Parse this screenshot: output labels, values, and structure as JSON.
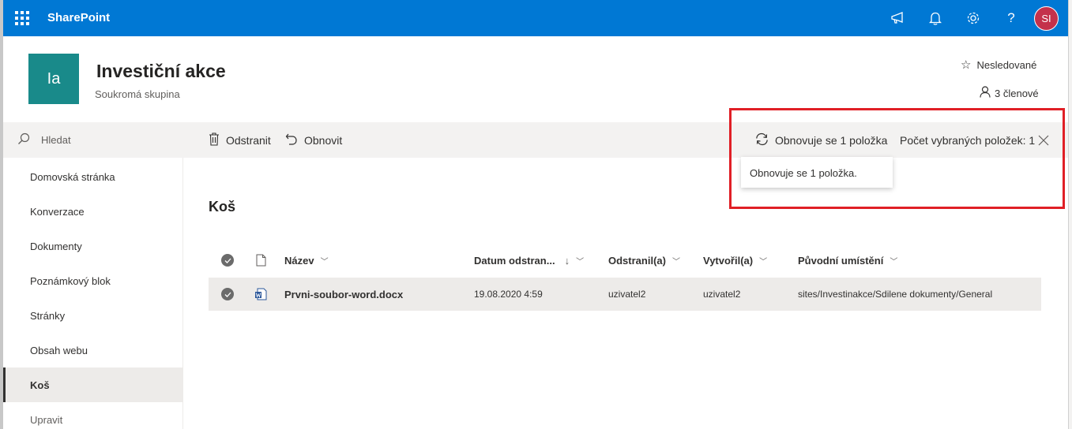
{
  "suite_bar": {
    "app_title": "SharePoint",
    "avatar_initials": "SI",
    "bg_color": "#0078d4",
    "icons": [
      "waffle-icon",
      "megaphone-icon",
      "bell-icon",
      "gear-icon",
      "help-icon"
    ]
  },
  "site": {
    "logo_text": "Ia",
    "title": "Investiční akce",
    "subtitle": "Soukromá skupina",
    "follow_label": "Nesledované",
    "members_label": "3 členové"
  },
  "search": {
    "placeholder": "Hledat"
  },
  "command_bar": {
    "delete_label": "Odstranit",
    "restore_label": "Obnovit",
    "status_label": "Obnovuje se 1 položka",
    "selected_count_label": "Počet vybraných položek: 1"
  },
  "tooltip": {
    "text": "Obnovuje se 1 položka."
  },
  "left_nav": {
    "items": [
      {
        "label": "Domovská stránka"
      },
      {
        "label": "Konverzace"
      },
      {
        "label": "Dokumenty"
      },
      {
        "label": "Poznámkový blok"
      },
      {
        "label": "Stránky"
      },
      {
        "label": "Obsah webu"
      },
      {
        "label": "Koš",
        "selected": true
      }
    ],
    "edit_label": "Upravit"
  },
  "main": {
    "heading": "Koš",
    "columns": {
      "name": "Název",
      "deleted_date": "Datum odstran...",
      "deleted_by": "Odstranil(a)",
      "created_by": "Vytvořil(a)",
      "original_location": "Původní umístění"
    },
    "rows": [
      {
        "name": "Prvni-soubor-word.docx",
        "deleted_date": "19.08.2020 4:59",
        "deleted_by": "uzivatel2",
        "created_by": "uzivatel2",
        "original_location": "sites/Investinakce/Sdilene dokumenty/General",
        "file_icon": "word-file-icon"
      }
    ]
  },
  "highlight_color": "#e01f26"
}
